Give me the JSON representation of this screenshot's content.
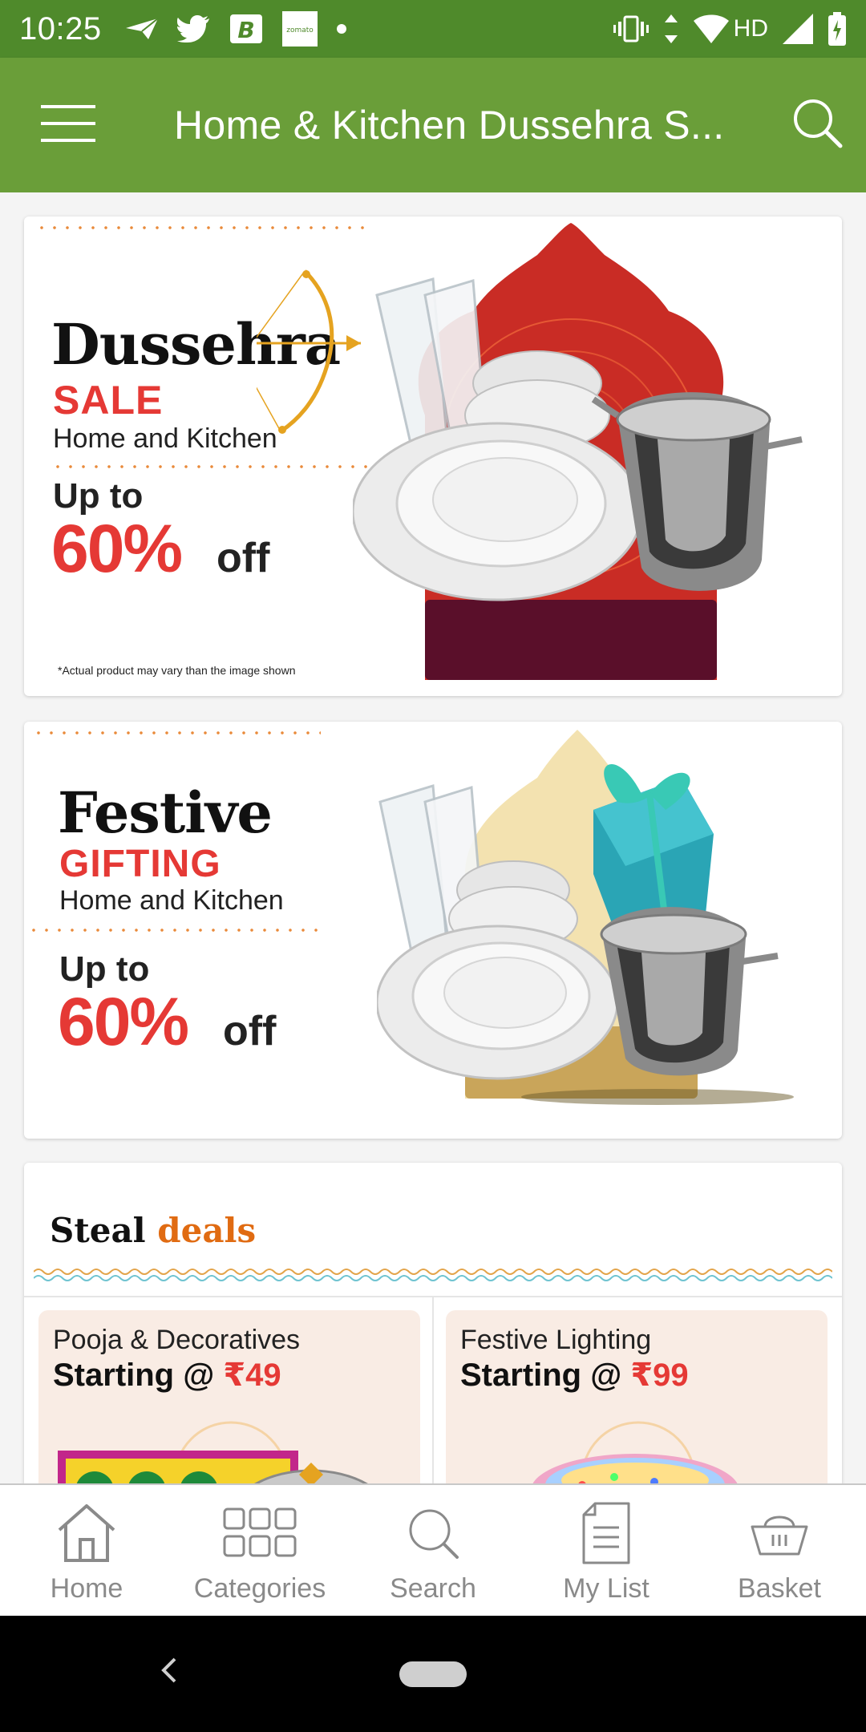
{
  "status_bar": {
    "time": "10:25",
    "network": "HD",
    "left_icons": [
      "send-icon",
      "twitter-icon",
      "b-app-icon",
      "zomato-icon",
      "dot-icon"
    ],
    "zomato_label": "zomato",
    "b_label": "B",
    "right_icons": [
      "vibrate-icon",
      "data-arrows-icon",
      "wifi-icon",
      "cell-signal-icon",
      "battery-icon"
    ]
  },
  "app_bar": {
    "title": "Home & Kitchen Dussehra S...",
    "menu_icon": "hamburger-menu-icon",
    "search_icon": "search-icon",
    "background": "#6a9e39"
  },
  "banners": [
    {
      "title": "Dussehra",
      "subtitle": "SALE",
      "category": "Home and Kitchen",
      "upto": "Up to",
      "discount": "60%",
      "off": "off",
      "note": "*Actual product may vary than the image shown"
    },
    {
      "title": "Festive",
      "subtitle": "GIFTING",
      "category": "Home and Kitchen",
      "upto": "Up to",
      "discount": "60%",
      "off": "off"
    }
  ],
  "steal_deals": {
    "title_main": "Steal",
    "title_highlight": "deals",
    "items": [
      {
        "name": "Pooja & Decoratives",
        "price_prefix": "Starting @ ",
        "price": "₹49"
      },
      {
        "name": "Festive Lighting",
        "price_prefix": "Starting @ ",
        "price": "₹99"
      }
    ]
  },
  "bottom_nav": {
    "items": [
      {
        "label": "Home",
        "icon": "home-icon"
      },
      {
        "label": "Categories",
        "icon": "categories-grid-icon"
      },
      {
        "label": "Search",
        "icon": "search-icon"
      },
      {
        "label": "My List",
        "icon": "list-document-icon"
      },
      {
        "label": "Basket",
        "icon": "basket-icon"
      }
    ]
  },
  "colors": {
    "status_bar": "#4f8a2b",
    "accent_red": "#e53935",
    "accent_orange": "#e06b12"
  }
}
